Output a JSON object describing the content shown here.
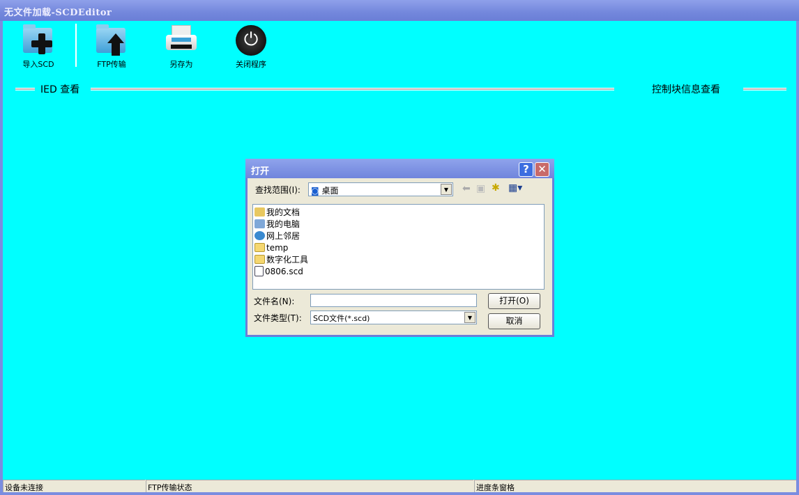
{
  "window": {
    "title": "无文件加载-SCDEditor"
  },
  "toolbar": [
    {
      "label": "导入SCD",
      "icon": "folder-add-icon"
    },
    {
      "label": "FTP传输",
      "icon": "folder-upload-icon"
    },
    {
      "label": "另存为",
      "icon": "printer-icon"
    },
    {
      "label": "关闭程序",
      "icon": "power-icon"
    }
  ],
  "groups": {
    "left": "IED 查看",
    "right": "控制块信息查看"
  },
  "dialog": {
    "title": "打开",
    "look_in_label": "查找范围(I):",
    "look_in_value": "桌面",
    "files": [
      {
        "name": "我的文档",
        "icon": "my-documents-icon"
      },
      {
        "name": "我的电脑",
        "icon": "my-computer-icon"
      },
      {
        "name": "网上邻居",
        "icon": "network-icon"
      },
      {
        "name": "temp",
        "icon": "folder-icon"
      },
      {
        "name": "数字化工具",
        "icon": "folder-icon"
      },
      {
        "name": "0806.scd",
        "icon": "file-icon"
      }
    ],
    "filename_label": "文件名(N):",
    "filename_value": "",
    "filetype_label": "文件类型(T):",
    "filetype_value": "SCD文件(*.scd)",
    "open_label": "打开(O)",
    "cancel_label": "取消"
  },
  "status": [
    "设备未连接",
    "FTP传输状态",
    "进度条窗格"
  ]
}
